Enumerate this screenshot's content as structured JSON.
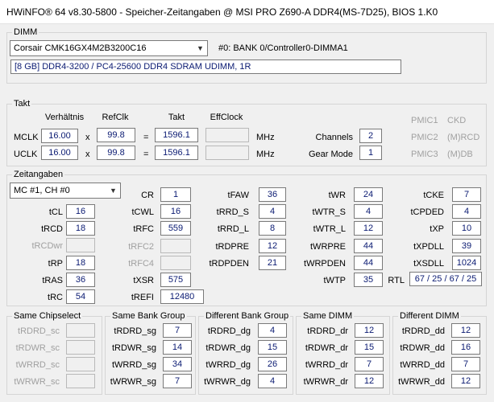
{
  "window": {
    "title": "HWiNFO® 64 v8.30-5800 - Speicher-Zeitangaben @ MSI PRO Z690-A DDR4(MS-7D25), BIOS 1.K0"
  },
  "dimm": {
    "label": "DIMM",
    "module_select": "Corsair CMK16GX4M2B3200C16",
    "location": "#0: BANK 0/Controller0-DIMMA1",
    "description": "[8 GB] DDR4-3200 / PC4-25600 DDR4 SDRAM UDIMM, 1R"
  },
  "takt": {
    "label": "Takt",
    "headers": {
      "ratio": "Verhältnis",
      "refclk": "RefClk",
      "takt": "Takt",
      "eff": "EffClock"
    },
    "mclk": {
      "label": "MCLK",
      "ratio": "16.00",
      "x": "x",
      "refclk": "99.8",
      "eq": "=",
      "takt": "1596.1",
      "eff": "",
      "unit": "MHz"
    },
    "uclk": {
      "label": "UCLK",
      "ratio": "16.00",
      "x": "x",
      "refclk": "99.8",
      "eq": "=",
      "takt": "1596.1",
      "eff": "",
      "unit": "MHz"
    },
    "channels": {
      "label": "Channels",
      "value": "2"
    },
    "gear_mode": {
      "label": "Gear Mode",
      "value": "1"
    },
    "pmic": [
      {
        "label": "PMIC1",
        "value": "CKD"
      },
      {
        "label": "PMIC2",
        "value": "(M)RCD"
      },
      {
        "label": "PMIC3",
        "value": "(M)DB"
      }
    ]
  },
  "zeit": {
    "label": "Zeitangaben",
    "channel_select": "MC #1, CH #0",
    "col1": [
      {
        "label": "tCL",
        "value": "16",
        "dis": false
      },
      {
        "label": "tRCD",
        "value": "18",
        "dis": false
      },
      {
        "label": "tRCDwr",
        "value": "",
        "dis": true
      },
      {
        "label": "tRP",
        "value": "18",
        "dis": false
      },
      {
        "label": "tRAS",
        "value": "36",
        "dis": false
      },
      {
        "label": "tRC",
        "value": "54",
        "dis": false
      }
    ],
    "col2": [
      {
        "label": "CR",
        "value": "1",
        "dis": false
      },
      {
        "label": "tCWL",
        "value": "16",
        "dis": false
      },
      {
        "label": "tRFC",
        "value": "559",
        "dis": false
      },
      {
        "label": "tRFC2",
        "value": "",
        "dis": true
      },
      {
        "label": "tRFC4",
        "value": "",
        "dis": true
      },
      {
        "label": "tXSR",
        "value": "575",
        "dis": false
      },
      {
        "label": "tREFI",
        "value": "12480",
        "dis": false
      }
    ],
    "col3": [
      {
        "label": "tFAW",
        "value": "36",
        "dis": false
      },
      {
        "label": "tRRD_S",
        "value": "4",
        "dis": false
      },
      {
        "label": "tRRD_L",
        "value": "8",
        "dis": false
      },
      {
        "label": "tRDPRE",
        "value": "12",
        "dis": false
      },
      {
        "label": "tRDPDEN",
        "value": "21",
        "dis": false
      }
    ],
    "col4": [
      {
        "label": "tWR",
        "value": "24",
        "dis": false
      },
      {
        "label": "tWTR_S",
        "value": "4",
        "dis": false
      },
      {
        "label": "tWTR_L",
        "value": "12",
        "dis": false
      },
      {
        "label": "tWRPRE",
        "value": "44",
        "dis": false
      },
      {
        "label": "tWRPDEN",
        "value": "44",
        "dis": false
      },
      {
        "label": "tWTP",
        "value": "35",
        "dis": false
      }
    ],
    "col5": [
      {
        "label": "tCKE",
        "value": "7",
        "dis": false
      },
      {
        "label": "tCPDED",
        "value": "4",
        "dis": false
      },
      {
        "label": "tXP",
        "value": "10",
        "dis": false
      },
      {
        "label": "tXPDLL",
        "value": "39",
        "dis": false
      },
      {
        "label": "tXSDLL",
        "value": "1024",
        "dis": false
      }
    ],
    "rtl": {
      "label": "RTL",
      "value": "67 / 25 / 67 / 25"
    }
  },
  "bottom": [
    {
      "label": "Same Chipselect",
      "rows": [
        {
          "label": "tRDRD_sc",
          "value": "",
          "dis": true
        },
        {
          "label": "tRDWR_sc",
          "value": "",
          "dis": true
        },
        {
          "label": "tWRRD_sc",
          "value": "",
          "dis": true
        },
        {
          "label": "tWRWR_sc",
          "value": "",
          "dis": true
        }
      ]
    },
    {
      "label": "Same Bank Group",
      "rows": [
        {
          "label": "tRDRD_sg",
          "value": "7",
          "dis": false
        },
        {
          "label": "tRDWR_sg",
          "value": "14",
          "dis": false
        },
        {
          "label": "tWRRD_sg",
          "value": "34",
          "dis": false
        },
        {
          "label": "tWRWR_sg",
          "value": "7",
          "dis": false
        }
      ]
    },
    {
      "label": "Different Bank Group",
      "rows": [
        {
          "label": "tRDRD_dg",
          "value": "4",
          "dis": false
        },
        {
          "label": "tRDWR_dg",
          "value": "15",
          "dis": false
        },
        {
          "label": "tWRRD_dg",
          "value": "26",
          "dis": false
        },
        {
          "label": "tWRWR_dg",
          "value": "4",
          "dis": false
        }
      ]
    },
    {
      "label": "Same DIMM",
      "rows": [
        {
          "label": "tRDRD_dr",
          "value": "12",
          "dis": false
        },
        {
          "label": "tRDWR_dr",
          "value": "15",
          "dis": false
        },
        {
          "label": "tWRRD_dr",
          "value": "7",
          "dis": false
        },
        {
          "label": "tWRWR_dr",
          "value": "12",
          "dis": false
        }
      ]
    },
    {
      "label": "Different DIMM",
      "rows": [
        {
          "label": "tRDRD_dd",
          "value": "12",
          "dis": false
        },
        {
          "label": "tRDWR_dd",
          "value": "16",
          "dis": false
        },
        {
          "label": "tWRRD_dd",
          "value": "7",
          "dis": false
        },
        {
          "label": "tWRWR_dd",
          "value": "12",
          "dis": false
        }
      ]
    }
  ]
}
